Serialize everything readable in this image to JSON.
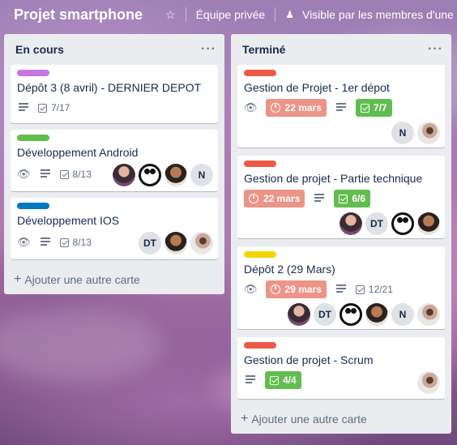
{
  "header": {
    "board_title": "Projet smartphone",
    "team": "Équipe privée",
    "visibility": "Visible par les membres d'une"
  },
  "lists": [
    {
      "title": "En cours",
      "add_card": "Ajouter une autre carte",
      "cards": [
        {
          "label_color": "#c377e0",
          "title": "Dépôt 3 (8 avril) - DERNIER DEPOT",
          "checklist": "7/17"
        },
        {
          "label_color": "#61bd4f",
          "title": "Développement Android",
          "checklist": "8/13",
          "members": [
            "",
            "",
            "",
            "N"
          ]
        },
        {
          "label_color": "#0079bf",
          "title": "Développement IOS",
          "checklist": "8/13",
          "members": [
            "DT",
            "",
            ""
          ]
        }
      ]
    },
    {
      "title": "Terminé",
      "add_card": "Ajouter une autre carte",
      "cards": [
        {
          "label_color": "#eb5a46",
          "title": "Gestion de Projet - 1er dépot",
          "due": "22 mars",
          "checklist": "7/7",
          "members": [
            "N",
            ""
          ]
        },
        {
          "label_color": "#eb5a46",
          "title": "Gestion de projet - Partie technique",
          "due": "22 mars",
          "checklist": "6/6",
          "members": [
            "",
            "DT",
            "",
            ""
          ]
        },
        {
          "label_color": "#f2d600",
          "title": "Dépôt 2 (29 Mars)",
          "due": "29 mars",
          "checklist": "12/21",
          "members": [
            "",
            "DT",
            "",
            "",
            "N",
            ""
          ]
        },
        {
          "label_color": "#eb5a46",
          "title": "Gestion de projet - Scrum",
          "checklist": "4/4",
          "members": [
            ""
          ]
        }
      ]
    }
  ]
}
